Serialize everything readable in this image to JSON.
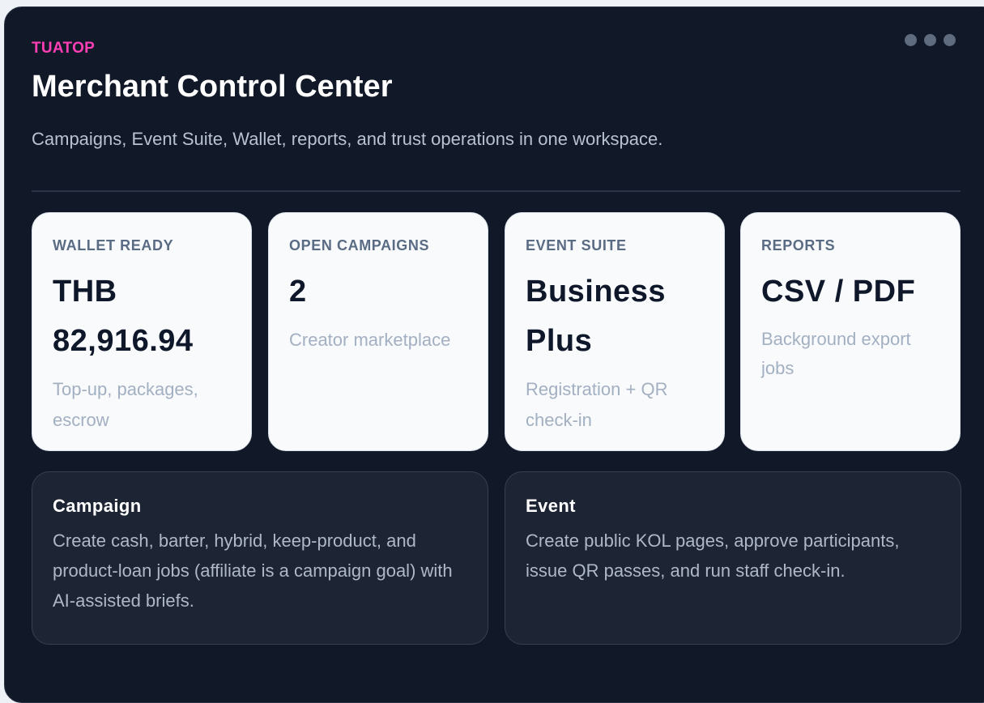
{
  "header": {
    "brand": "TUATOP",
    "title": "Merchant Control Center",
    "subtitle": "Campaigns, Event Suite, Wallet, reports, and trust operations in one workspace."
  },
  "menu": {
    "icon": "more-dots-icon"
  },
  "stats": [
    {
      "label": "WALLET READY",
      "value": "THB 82,916.94",
      "note": "Top-up, packages, escrow"
    },
    {
      "label": "OPEN CAMPAIGNS",
      "value": "2",
      "note": "Creator marketplace"
    },
    {
      "label": "EVENT SUITE",
      "value": "Business Plus",
      "note": "Registration + QR check-in"
    },
    {
      "label": "REPORTS",
      "value": "CSV / PDF",
      "note": "Background export jobs"
    }
  ],
  "features": [
    {
      "title": "Campaign",
      "description": "Create cash, barter, hybrid, keep-product, and product-loan jobs (affiliate is a campaign goal) with AI-assisted briefs."
    },
    {
      "title": "Event",
      "description": "Create public KOL pages, approve participants, issue QR passes, and run staff check-in."
    }
  ],
  "colors": {
    "page_background": "#111827",
    "brand": "#ff3fb5",
    "stat_card_background": "#f8fafc",
    "feature_card_background": "#1d2433"
  }
}
